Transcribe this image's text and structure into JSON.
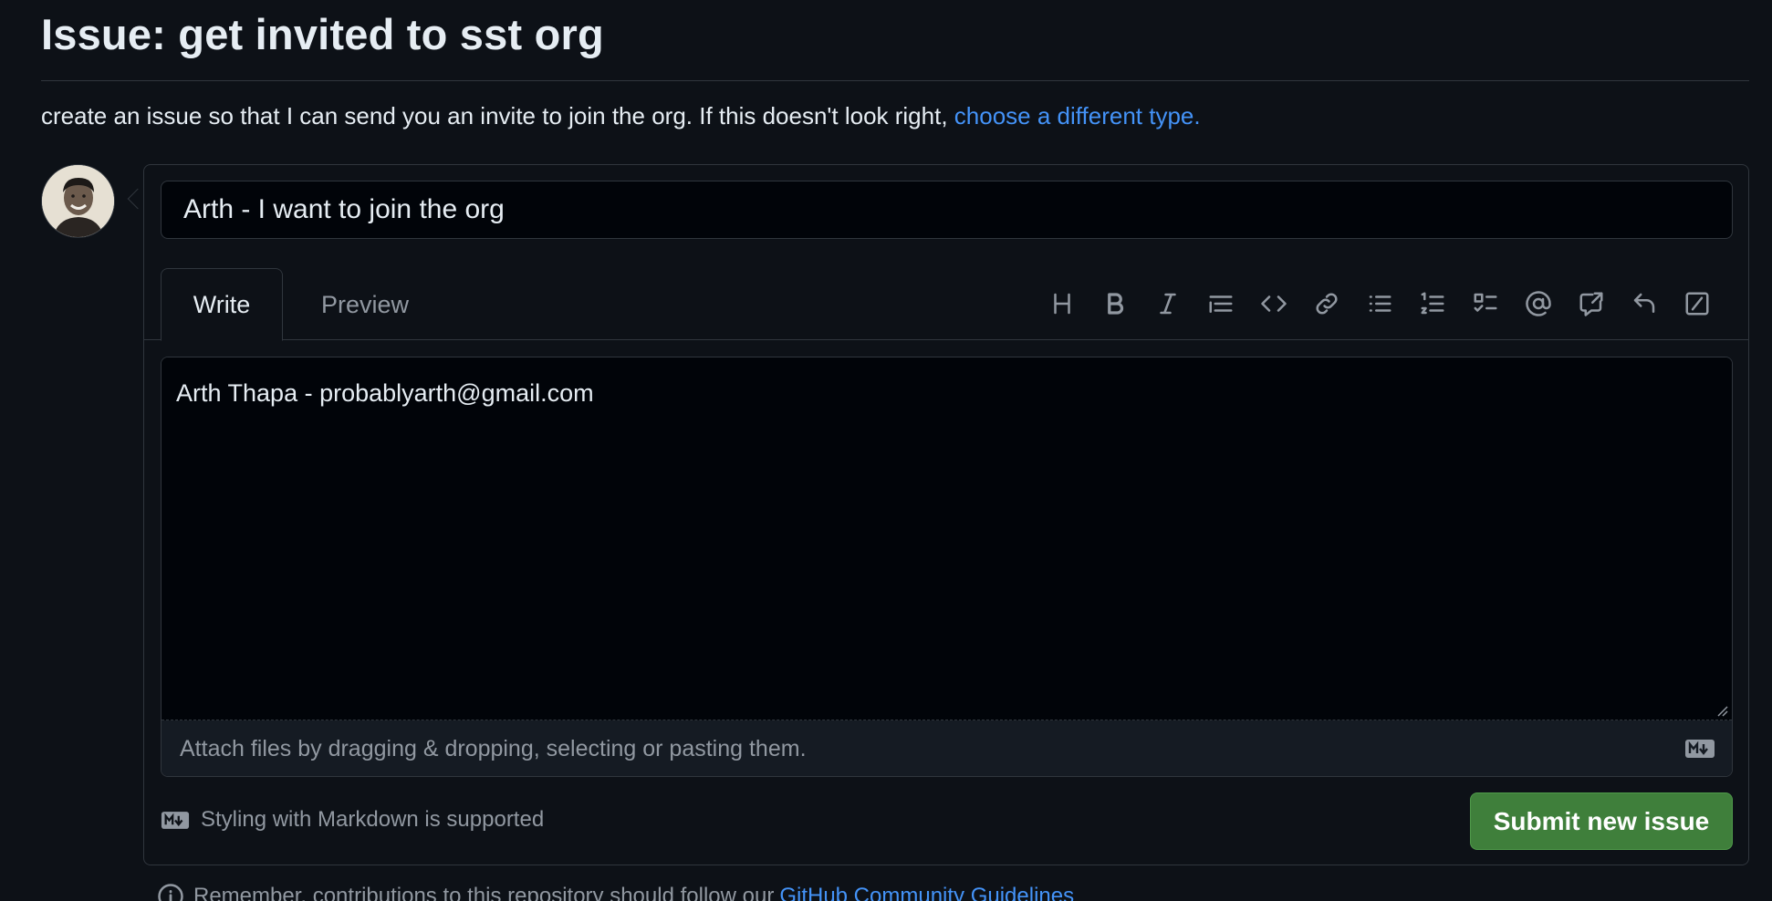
{
  "page": {
    "title": "Issue: get invited to sst org",
    "description": "create an issue so that I can send you an invite to join the org. If this doesn't look right,",
    "description_link": "choose a different type."
  },
  "issue": {
    "title_value": "Arth - I want to join the org",
    "body_value": "Arth Thapa - probablyarth@gmail.com"
  },
  "tabs": {
    "write": "Write",
    "preview": "Preview"
  },
  "toolbar": {
    "items": [
      "heading-icon",
      "bold-icon",
      "italic-icon",
      "quote-icon",
      "code-icon",
      "link-icon",
      "unordered-list-icon",
      "ordered-list-icon",
      "task-list-icon",
      "mention-icon",
      "reference-icon",
      "reply-icon",
      "slash-commands-icon"
    ]
  },
  "attach": {
    "text": "Attach files by dragging & dropping, selecting or pasting them."
  },
  "markdown_note": "Styling with Markdown is supported",
  "submit_label": "Submit new issue",
  "footer": {
    "text": "Remember, contributions to this repository should follow our",
    "link": "GitHub Community Guidelines"
  },
  "colors": {
    "background": "#0d1117",
    "link": "#4493f8",
    "submit": "#3f7f3b",
    "border": "#30363d"
  }
}
